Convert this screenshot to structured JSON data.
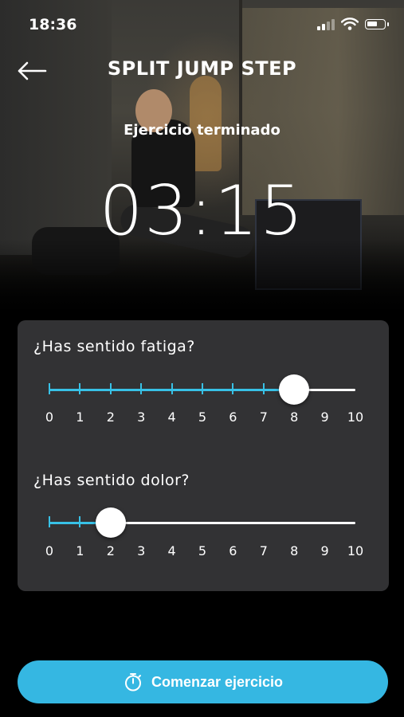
{
  "status_bar": {
    "time": "18:36"
  },
  "header": {
    "title": "SPLIT JUMP STEP",
    "subtitle": "Ejercicio terminado"
  },
  "timer": {
    "value": "03:15"
  },
  "questions": [
    {
      "label": "¿Has sentido fatiga?",
      "value": 8,
      "min": 0,
      "max": 10,
      "scale": [
        "0",
        "1",
        "2",
        "3",
        "4",
        "5",
        "6",
        "7",
        "8",
        "9",
        "10"
      ]
    },
    {
      "label": "¿Has sentido dolor?",
      "value": 2,
      "min": 0,
      "max": 10,
      "scale": [
        "0",
        "1",
        "2",
        "3",
        "4",
        "5",
        "6",
        "7",
        "8",
        "9",
        "10"
      ]
    }
  ],
  "cta": {
    "label": "Comenzar ejercicio",
    "icon": "stopwatch-icon"
  },
  "colors": {
    "accent": "#35b7e2",
    "card": "#323234",
    "background": "#000000"
  }
}
